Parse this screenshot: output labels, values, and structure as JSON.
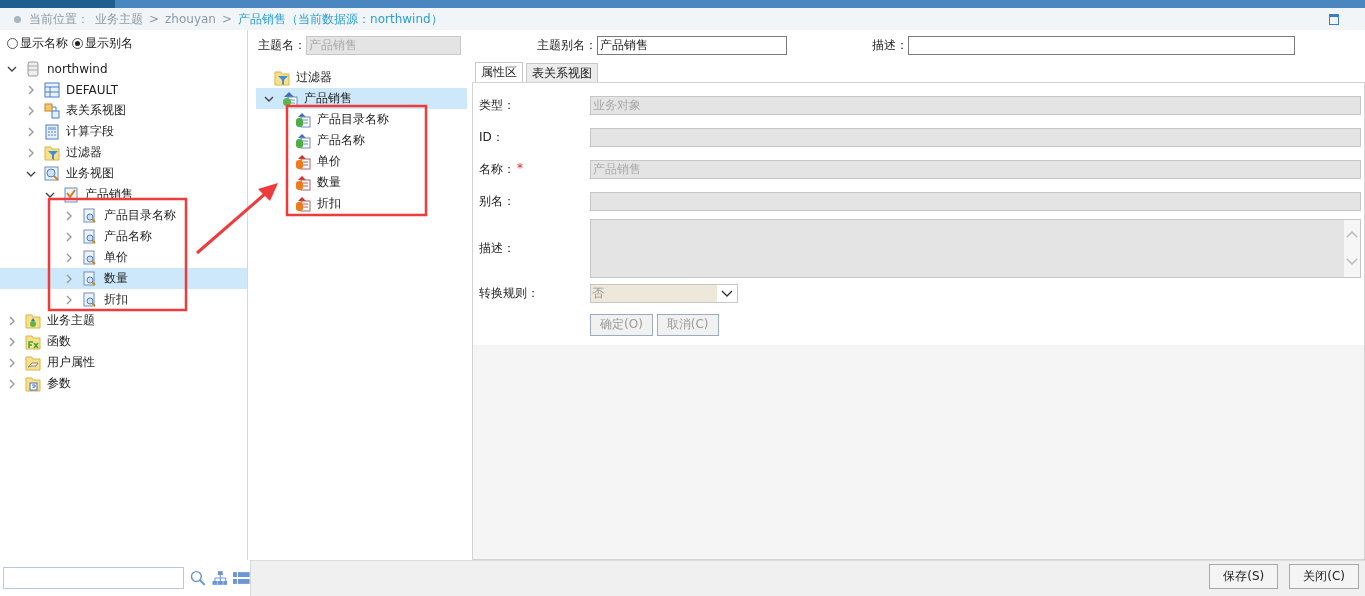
{
  "breadcrumb": [
    {
      "kind": "label",
      "text": "当前位置："
    },
    {
      "kind": "link",
      "text": "业务主题"
    },
    {
      "kind": "sep",
      "text": ">"
    },
    {
      "kind": "link",
      "text": "zhouyan"
    },
    {
      "kind": "sep",
      "text": ">"
    },
    {
      "kind": "current",
      "text": "产品销售（当前数据源：northwind）"
    }
  ],
  "display_mode": [
    {
      "label": "显示名称",
      "selected": false
    },
    {
      "label": "显示别名",
      "selected": true
    }
  ],
  "resource_tree": [
    {
      "label": "northwind",
      "kind": "db",
      "expanded": true,
      "selected": false,
      "children": [
        {
          "label": "DEFAULT",
          "kind": "schema",
          "expanded": false,
          "selected": false
        },
        {
          "label": "表关系视图",
          "kind": "relation",
          "expanded": false,
          "selected": false
        },
        {
          "label": "计算字段",
          "kind": "calc",
          "expanded": false,
          "selected": false
        },
        {
          "label": "过滤器",
          "kind": "filter",
          "expanded": false,
          "selected": false
        },
        {
          "label": "业务视图",
          "kind": "view",
          "expanded": true,
          "selected": false,
          "children": [
            {
              "label": "产品销售",
              "kind": "viewobj",
              "expanded": true,
              "selected": false,
              "children": [
                {
                  "label": "产品目录名称",
                  "kind": "viewfield",
                  "expanded": false,
                  "selected": false
                },
                {
                  "label": "产品名称",
                  "kind": "viewfield",
                  "expanded": false,
                  "selected": false
                },
                {
                  "label": "单价",
                  "kind": "viewfield",
                  "expanded": false,
                  "selected": false
                },
                {
                  "label": "数量",
                  "kind": "viewfield",
                  "expanded": false,
                  "selected": true
                },
                {
                  "label": "折扣",
                  "kind": "viewfield",
                  "expanded": false,
                  "selected": false
                }
              ]
            }
          ]
        }
      ]
    },
    {
      "label": "业务主题",
      "kind": "subject",
      "expanded": false,
      "selected": false
    },
    {
      "label": "函数",
      "kind": "func",
      "expanded": false,
      "selected": false
    },
    {
      "label": "用户属性",
      "kind": "userattr",
      "expanded": false,
      "selected": false
    },
    {
      "label": "参数",
      "kind": "param",
      "expanded": false,
      "selected": false
    }
  ],
  "header_fields": [
    {
      "label": "主题名：",
      "value": "产品销售",
      "disabled": true
    },
    {
      "label": "主题别名：",
      "value": "产品销售",
      "disabled": false
    },
    {
      "label": "描述：",
      "disabled": false
    }
  ],
  "subject_tree": [
    {
      "label": "过滤器",
      "kind": "filter",
      "selected": false
    },
    {
      "label": "产品销售",
      "kind": "bizobj",
      "expanded": true,
      "selected": true,
      "children": [
        {
          "label": "产品目录名称",
          "kind": "dim",
          "selected": false
        },
        {
          "label": "产品名称",
          "kind": "dim",
          "selected": false
        },
        {
          "label": "单价",
          "kind": "measure",
          "selected": false
        },
        {
          "label": "数量",
          "kind": "measure",
          "selected": false
        },
        {
          "label": "折扣",
          "kind": "measure",
          "selected": false
        }
      ]
    }
  ],
  "tabs": [
    {
      "label": "属性区",
      "selected": true
    },
    {
      "label": "表关系视图",
      "selected": false
    }
  ],
  "properties": [
    {
      "kind": "text",
      "label": "类型：",
      "value": "业务对象"
    },
    {
      "kind": "text",
      "label": "ID："
    },
    {
      "kind": "text",
      "label": "名称：",
      "required_mark": "*",
      "value": "产品销售"
    },
    {
      "kind": "text",
      "label": "别名："
    },
    {
      "kind": "textarea",
      "label": "描述："
    },
    {
      "kind": "select",
      "label": "转换规则：",
      "value": "否"
    }
  ],
  "form_buttons": [
    {
      "label": "确定(O)",
      "disabled": true
    },
    {
      "label": "取消(C)",
      "disabled": true
    }
  ],
  "footer_buttons": [
    "保存(S)",
    "关闭(C)"
  ]
}
